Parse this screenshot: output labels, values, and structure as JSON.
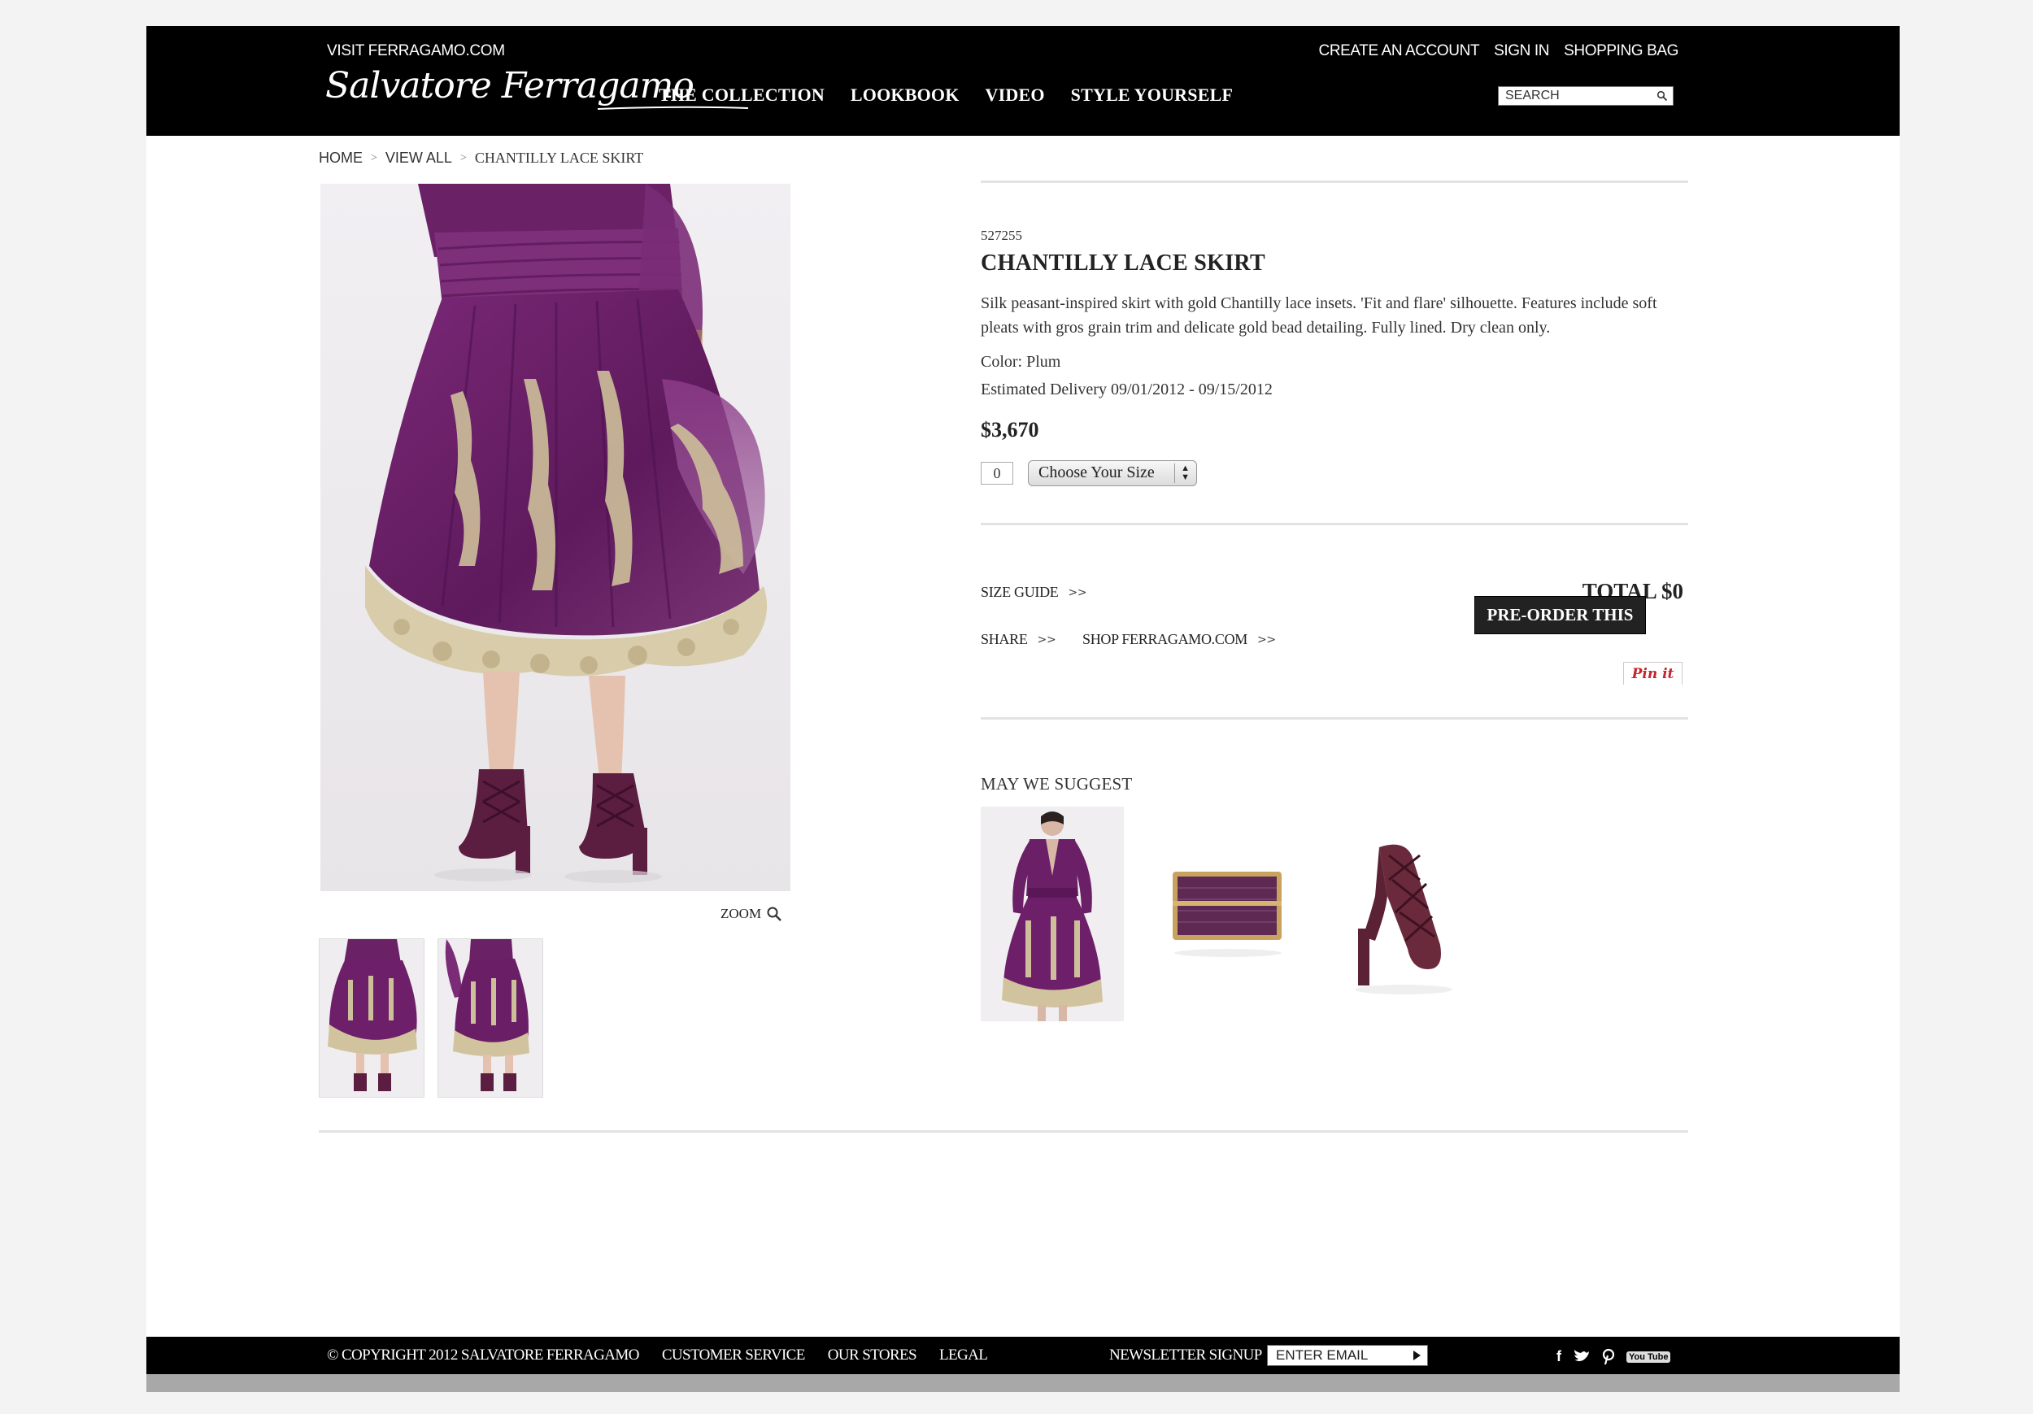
{
  "header": {
    "visit_link": "VISIT FERRAGAMO.COM",
    "logo_text": "Salvatore Ferragamo",
    "nav": [
      "THE COLLECTION",
      "LOOKBOOK",
      "VIDEO",
      "STYLE YOURSELF"
    ],
    "account": {
      "create": "CREATE AN ACCOUNT",
      "sign_in": "SIGN IN",
      "bag": "SHOPPING BAG"
    },
    "search": {
      "placeholder": "SEARCH",
      "icon": "search-icon"
    }
  },
  "breadcrumb": {
    "home": "HOME",
    "view_all": "VIEW ALL",
    "current": "CHANTILLY LACE SKIRT",
    "separator": ">"
  },
  "gallery": {
    "zoom_label": "ZOOM",
    "zoom_icon": "magnifier-icon",
    "thumbnail_count": 2
  },
  "product": {
    "sku": "527255",
    "name": "CHANTILLY LACE SKIRT",
    "description": "Silk peasant-inspired skirt with gold Chantilly lace insets. 'Fit and flare' silhouette. Features include soft pleats with gros grain trim and delicate gold bead detailing. Fully lined. Dry clean only.",
    "color_line": "Color: Plum",
    "delivery_line": "Estimated Delivery 09/01/2012 - 09/15/2012",
    "price": "$3,670",
    "quantity": "0",
    "size_select": "Choose Your Size",
    "size_guide": "SIZE GUIDE",
    "share": "SHARE",
    "shop": "SHOP FERRAGAMO.COM",
    "link_chevron": ">>",
    "total": "TOTAL $0",
    "preorder": "PRE-ORDER THIS ITEM",
    "pinit": "Pin it"
  },
  "suggest": {
    "heading": "MAY WE SUGGEST",
    "items": [
      "dress",
      "clutch",
      "sandal"
    ]
  },
  "footer": {
    "copyright": "© COPYRIGHT 2012 SALVATORE FERRAGAMO",
    "links": [
      "CUSTOMER SERVICE",
      "OUR STORES",
      "LEGAL"
    ],
    "newsletter_label": "NEWSLETTER SIGNUP",
    "email_placeholder": "ENTER EMAIL",
    "social": [
      "facebook-icon",
      "twitter-icon",
      "pinterest-icon",
      "youtube-icon"
    ],
    "youtube_text": "You Tube"
  },
  "colors": {
    "header_bg": "#000000",
    "plum": "#6e1f6a",
    "lace_gold": "#cdbf9a",
    "button_bg": "#222222",
    "pin_red": "#c8232c"
  }
}
